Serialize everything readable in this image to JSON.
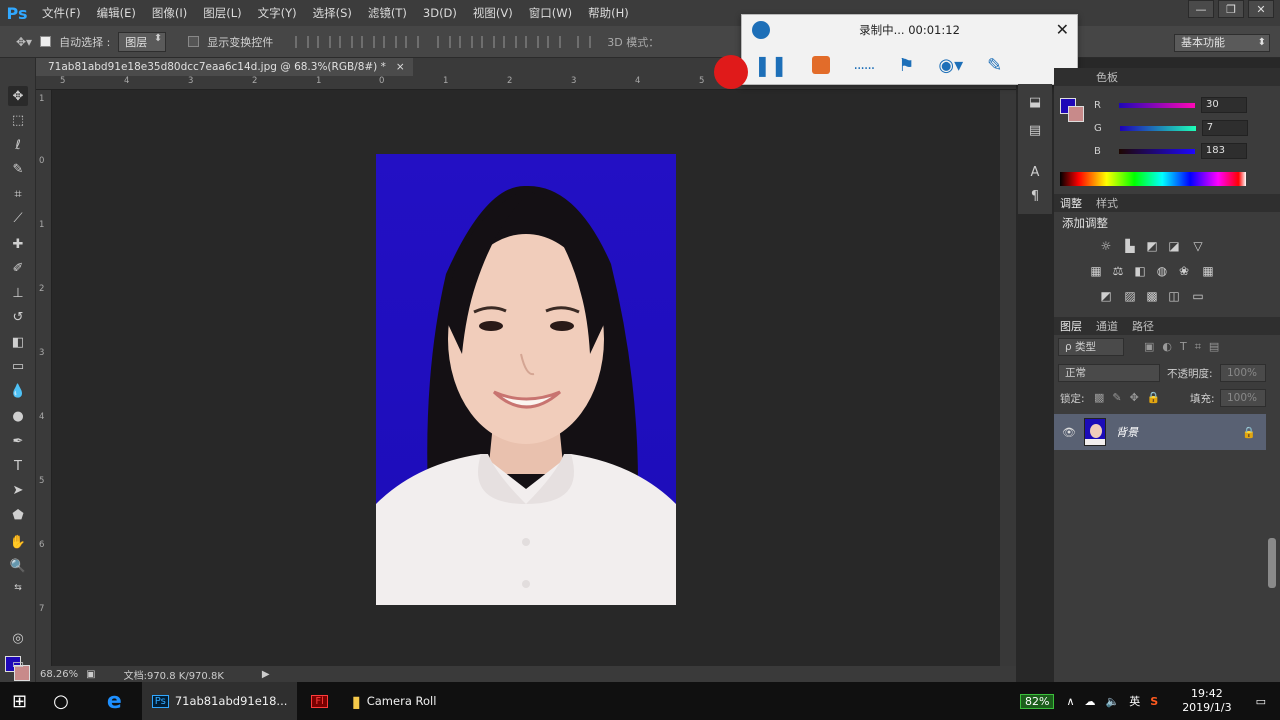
{
  "app": {
    "logo": "Ps",
    "menu": [
      "文件(F)",
      "编辑(E)",
      "图像(I)",
      "图层(L)",
      "文字(Y)",
      "选择(S)",
      "滤镜(T)",
      "3D(D)",
      "视图(V)",
      "窗口(W)",
      "帮助(H)"
    ],
    "window_controls": [
      "—",
      "❐",
      "✕"
    ]
  },
  "options_bar": {
    "auto_select_label": "自动选择 :",
    "auto_select_checked": true,
    "layer_select": "图层",
    "show_transform_label": "显示变换控件",
    "mode_3d_label": "3D 模式：",
    "workspace": "基本功能"
  },
  "document": {
    "tab_title": "71ab81abd91e18e35d80dcc7eaa6c14d.jpg @ 68.3%(RGB/8#) *",
    "close_icon": "×"
  },
  "ruler": {
    "top": [
      "5",
      "4",
      "3",
      "2",
      "1",
      "0",
      "1",
      "2",
      "3",
      "4",
      "5"
    ],
    "left": [
      "1",
      "0",
      "1",
      "2",
      "3",
      "4",
      "5",
      "6",
      "7"
    ]
  },
  "status": {
    "zoom": "68.26%",
    "doc_info": "文档:970.8 K/970.8K"
  },
  "recorder": {
    "title": "录制中... 00:01:12",
    "close": "✕",
    "dots": "......"
  },
  "color_panel": {
    "tabs": [
      "色板"
    ],
    "r_label": "R",
    "r_value": "30",
    "g_label": "G",
    "g_value": "7",
    "b_label": "B",
    "b_value": "183",
    "fg_color": "#1e07b7",
    "bg_color": "#c88a8a"
  },
  "adjust_panel": {
    "tabs": [
      "调整",
      "样式"
    ],
    "title": "添加调整"
  },
  "layers_panel": {
    "tabs": [
      "图层",
      "通道",
      "路径"
    ],
    "kind_filter": "ρ 类型",
    "blend_mode": "正常",
    "opacity_label": "不透明度:",
    "opacity_value": "100%",
    "lock_label": "锁定:",
    "fill_label": "填充:",
    "fill_value": "100%",
    "layer_name": "背景"
  },
  "taskbar": {
    "ps_task": "71ab81abd91e18...",
    "folder_task": "Camera Roll",
    "battery": "82%",
    "ime": "英",
    "time": "19:42",
    "date": "2019/1/3"
  }
}
